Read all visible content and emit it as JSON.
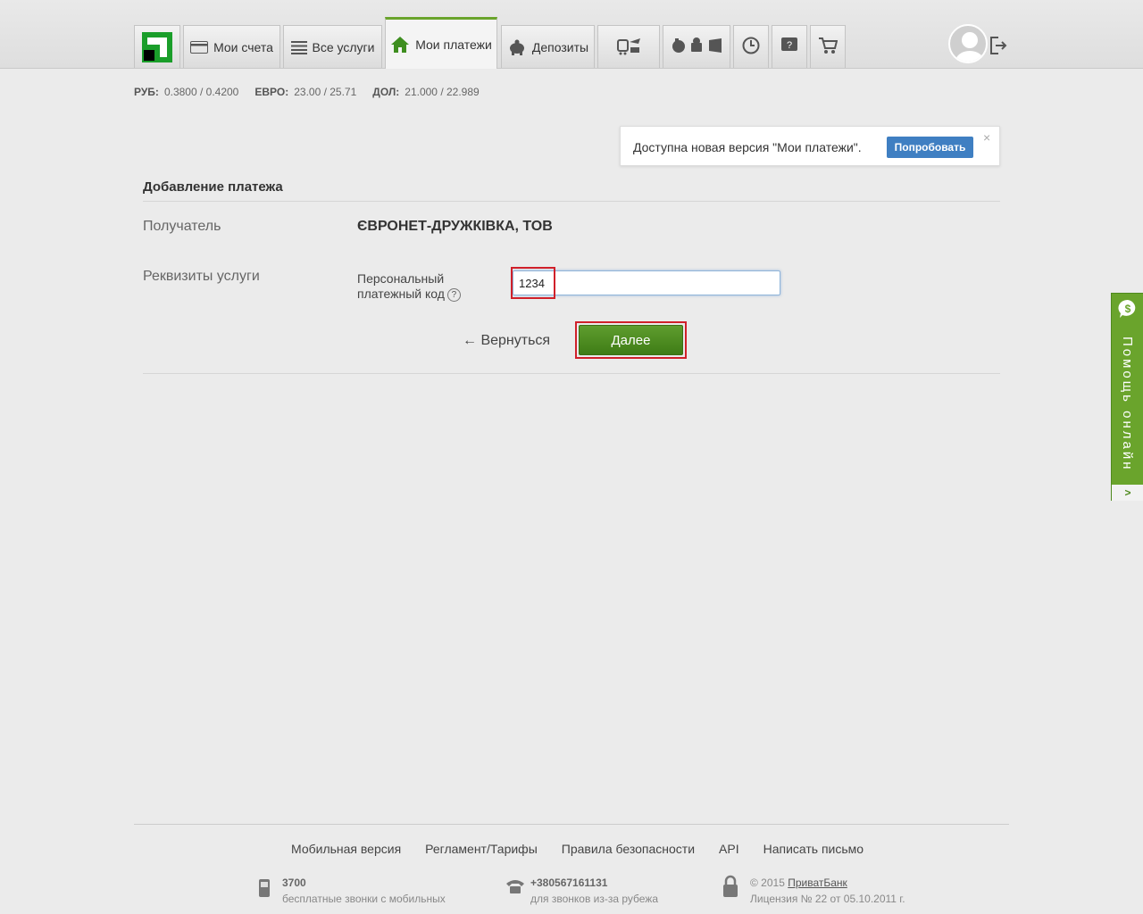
{
  "nav": {
    "tabs": [
      {
        "label": "Мои счета",
        "icon": "card-icon"
      },
      {
        "label": "Все услуги",
        "icon": "list-icon"
      },
      {
        "label": "Мои платежи",
        "icon": "home-icon",
        "active": true
      },
      {
        "label": "Депозиты",
        "icon": "piggy-bank-icon"
      }
    ],
    "icon_tabs": [
      "travel-icon",
      "ball-icon",
      "mobile-platforms-icon",
      "clock-icon",
      "help-icon",
      "cart-icon"
    ],
    "accent_color": "#6aa42c"
  },
  "rates": [
    {
      "label": "РУБ:",
      "value": "0.3800 / 0.4200"
    },
    {
      "label": "ЕВРО:",
      "value": "23.00 / 25.71"
    },
    {
      "label": "ДОЛ:",
      "value": "21.000 / 22.989"
    }
  ],
  "notice": {
    "text": "Доступна новая версия \"Мои платежи\".",
    "button": "Попробовать",
    "close": "×"
  },
  "form": {
    "title": "Добавление платежа",
    "recipient_label": "Получатель",
    "recipient_value": "ЄВРОНЕТ-ДРУЖКІВКА, ТОВ",
    "details_label": "Реквизиты услуги",
    "field_label_line1": "Персональный",
    "field_label_line2": "платежный код",
    "field_help": "?",
    "field_value": "1234",
    "back_label": "← Вернуться",
    "next_label": "Далее"
  },
  "help_tab": {
    "label": "Помощь онлайн",
    "arrow": ">"
  },
  "footer": {
    "links": [
      "Мобильная версия",
      "Регламент/Тарифы",
      "Правила безопасности",
      "API",
      "Написать письмо"
    ],
    "mobile_number": "3700",
    "mobile_caption": "бесплатные звонки с мобильных",
    "phone_number": "+380567161131",
    "phone_caption": "для звонков из-за рубежа",
    "copyright_prefix": "© 2015",
    "copyright_link": "ПриватБанк",
    "license": "Лицензия № 22 от 05.10.2011 г."
  }
}
